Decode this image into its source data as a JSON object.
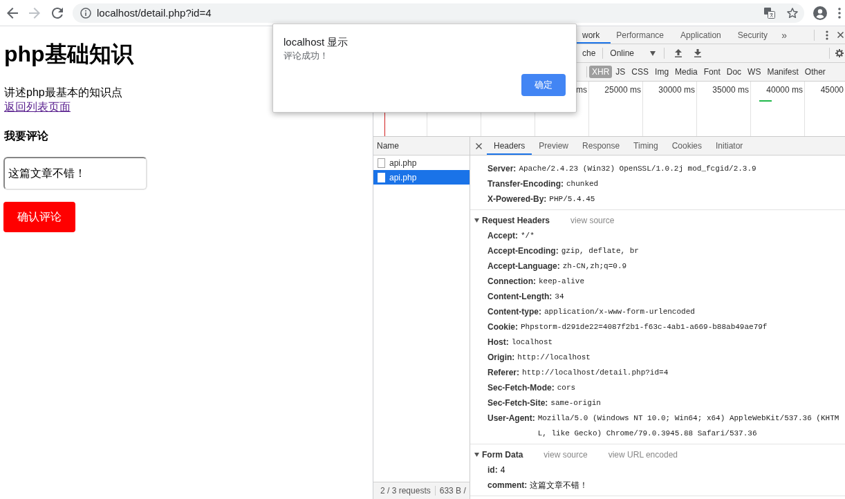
{
  "browser": {
    "url": "localhost/detail.php?id=4"
  },
  "page": {
    "title": "php基础知识",
    "description": "讲述php最基本的知识点",
    "back_link": "返回列表页面",
    "comment_heading": "我要评论",
    "comment_input": {
      "value": "这篇文章不错！"
    },
    "submit_button": "确认评论"
  },
  "alert": {
    "title": "localhost 显示",
    "message": "评论成功！",
    "button": "确定"
  },
  "devtools": {
    "tabs": [
      {
        "label": "work",
        "selected": true
      },
      {
        "label": "Performance",
        "selected": false
      },
      {
        "label": "Application",
        "selected": false
      },
      {
        "label": "Security",
        "selected": false
      }
    ],
    "more_tabs": "»",
    "toolbar": {
      "label": "che",
      "throttling": "Online"
    },
    "filters": [
      {
        "label": "XHR",
        "selected": true
      },
      {
        "label": "JS",
        "selected": false
      },
      {
        "label": "CSS",
        "selected": false
      },
      {
        "label": "Img",
        "selected": false
      },
      {
        "label": "Media",
        "selected": false
      },
      {
        "label": "Font",
        "selected": false
      },
      {
        "label": "Doc",
        "selected": false
      },
      {
        "label": "WS",
        "selected": false
      },
      {
        "label": "Manifest",
        "selected": false
      },
      {
        "label": "Other",
        "selected": false
      }
    ],
    "timeline": {
      "ticks": [
        "ms",
        "25000 ms",
        "30000 ms",
        "35000 ms",
        "40000 ms",
        "45000"
      ]
    },
    "requests": {
      "column": "Name",
      "rows": [
        {
          "name": "api.php",
          "selected": false
        },
        {
          "name": "api.php",
          "selected": true
        }
      ]
    },
    "status_bar": [
      "2 / 3 requests",
      "633 B /"
    ],
    "detail_tabs": [
      {
        "label": "Headers",
        "selected": true
      },
      {
        "label": "Preview",
        "selected": false
      },
      {
        "label": "Response",
        "selected": false
      },
      {
        "label": "Timing",
        "selected": false
      },
      {
        "label": "Cookies",
        "selected": false
      },
      {
        "label": "Initiator",
        "selected": false
      }
    ],
    "response_headers": [
      {
        "name": "Server:",
        "value": "Apache/2.4.23 (Win32) OpenSSL/1.0.2j mod_fcgid/2.3.9"
      },
      {
        "name": "Transfer-Encoding:",
        "value": "chunked"
      },
      {
        "name": "X-Powered-By:",
        "value": "PHP/5.4.45"
      }
    ],
    "sections": [
      {
        "title": "Request Headers",
        "kind": "headers",
        "expanded": true,
        "links": [
          "view source"
        ],
        "rows": [
          {
            "name": "Accept:",
            "value": "*/*"
          },
          {
            "name": "Accept-Encoding:",
            "value": "gzip, deflate, br"
          },
          {
            "name": "Accept-Language:",
            "value": "zh-CN,zh;q=0.9"
          },
          {
            "name": "Connection:",
            "value": "keep-alive"
          },
          {
            "name": "Content-Length:",
            "value": "34"
          },
          {
            "name": "Content-type:",
            "value": "application/x-www-form-urlencoded"
          },
          {
            "name": "Cookie:",
            "value": "Phpstorm-d291de22=4087f2b1-f63c-4ab1-a669-b88ab49ae79f"
          },
          {
            "name": "Host:",
            "value": "localhost"
          },
          {
            "name": "Origin:",
            "value": "http://localhost"
          },
          {
            "name": "Referer:",
            "value": "http://localhost/detail.php?id=4"
          },
          {
            "name": "Sec-Fetch-Mode:",
            "value": "cors"
          },
          {
            "name": "Sec-Fetch-Site:",
            "value": "same-origin"
          },
          {
            "name": "User-Agent:",
            "value": "Mozilla/5.0 (Windows NT 10.0; Win64; x64) AppleWebKit/537.36 (KHTML, like Gecko) Chrome/79.0.3945.88 Safari/537.36"
          }
        ]
      },
      {
        "title": "Form Data",
        "kind": "form",
        "expanded": true,
        "links": [
          "view source",
          "view URL encoded"
        ],
        "rows": [
          {
            "name": "id:",
            "value": "4"
          },
          {
            "name": "comment:",
            "value": "这篇文章不错！"
          }
        ]
      }
    ]
  }
}
